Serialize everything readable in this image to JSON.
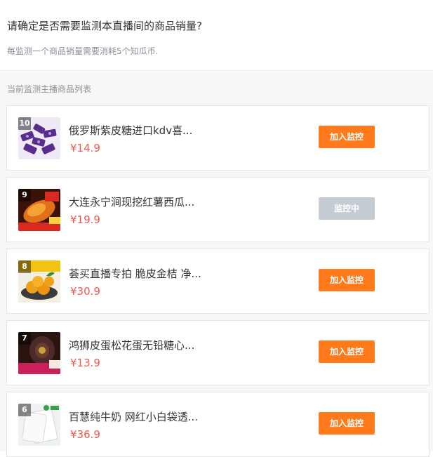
{
  "header": {
    "title": "请确定是否需要监测本直播间的商品销量?",
    "subtitle": "每监测一个商品销量需要消耗5个知瓜币."
  },
  "list": {
    "label": "当前监测主播商品列表",
    "items": [
      {
        "rank": "10",
        "name": "俄罗斯紫皮糖进口kdv喜...",
        "price": "¥14.9",
        "button": "加入监控",
        "state": "add"
      },
      {
        "rank": "9",
        "name": "大连永宁涧现挖红薯西瓜...",
        "price": "¥19.9",
        "button": "监控中",
        "state": "watching"
      },
      {
        "rank": "8",
        "name": "荟买直播专拍 脆皮金桔 净...",
        "price": "¥30.9",
        "button": "加入监控",
        "state": "add"
      },
      {
        "rank": "7",
        "name": "鸿狮皮蛋松花蛋无铅糖心...",
        "price": "¥13.9",
        "button": "加入监控",
        "state": "add"
      },
      {
        "rank": "6",
        "name": "百慧纯牛奶 网红小白袋透...",
        "price": "¥36.9",
        "button": "加入监控",
        "state": "add"
      }
    ]
  },
  "colors": {
    "accent": "#ff7a1a",
    "price": "#f0584d",
    "disabled": "#c5ccd3"
  }
}
